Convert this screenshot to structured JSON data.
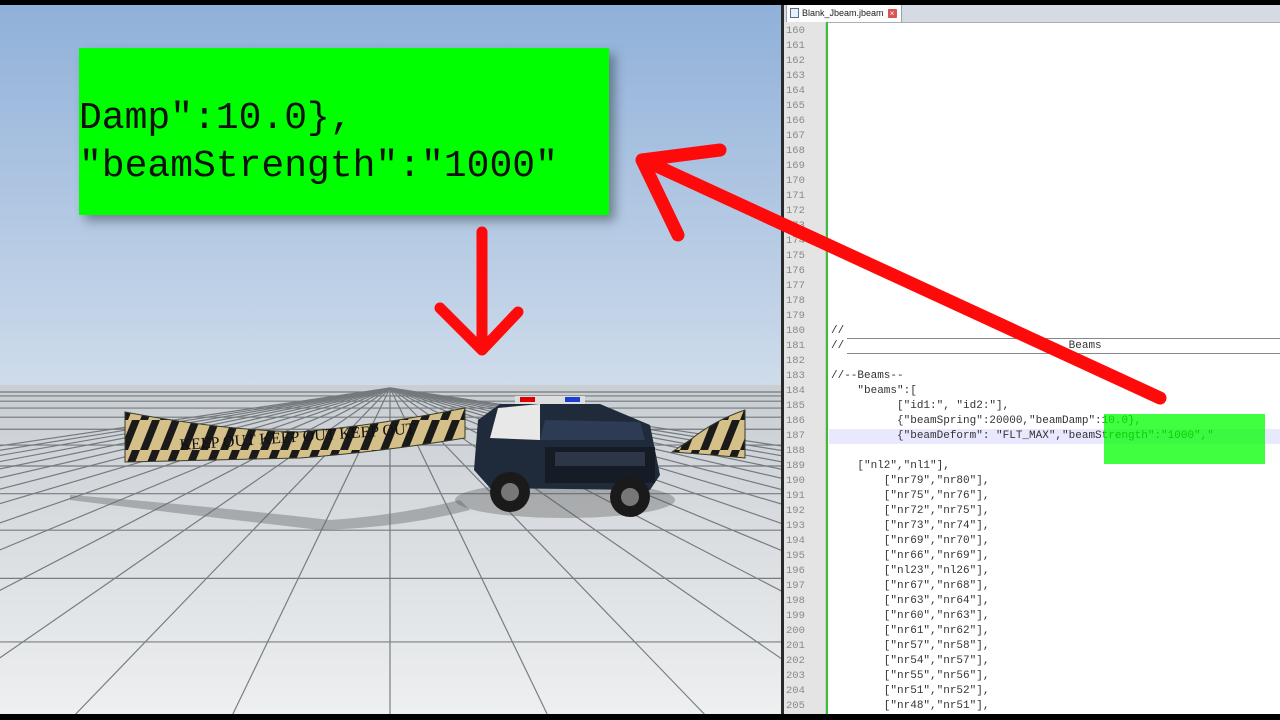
{
  "editor": {
    "tab_title": "Blank_Jbeam.jbeam",
    "line_numbers": [
      "160",
      "161",
      "162",
      "163",
      "164",
      "165",
      "166",
      "167",
      "168",
      "169",
      "170",
      "171",
      "172",
      "173",
      "174",
      "175",
      "176",
      "177",
      "178",
      "179",
      "180",
      "181",
      "182",
      "183",
      "184",
      "185",
      "186",
      "187",
      "188",
      "189",
      "190",
      "191",
      "192",
      "193",
      "194",
      "195",
      "196",
      "197",
      "198",
      "199",
      "200",
      "201",
      "202",
      "203",
      "204",
      "205"
    ],
    "code_lines": [
      {
        "line": "180",
        "text": "//"
      },
      {
        "line": "181",
        "text": "//                                  Beams"
      },
      {
        "line": "183",
        "text": "//--Beams--"
      },
      {
        "line": "184",
        "text": "    \"beams\":["
      },
      {
        "line": "185",
        "text": "          [\"id1:\", \"id2:\"],"
      },
      {
        "line": "186",
        "text": "          {\"beamSpring\":20000,\"beamDamp\":10.0},"
      },
      {
        "line": "187",
        "text": "          {\"beamDeform\": \"FLT_MAX\",\"beamStrength\":\"1000\",\""
      },
      {
        "line": "189",
        "text": "    [\"nl2\",\"nl1\"],"
      },
      {
        "line": "190",
        "text": "        [\"nr79\",\"nr80\"],"
      },
      {
        "line": "191",
        "text": "        [\"nr75\",\"nr76\"],"
      },
      {
        "line": "192",
        "text": "        [\"nr72\",\"nr75\"],"
      },
      {
        "line": "193",
        "text": "        [\"nr73\",\"nr74\"],"
      },
      {
        "line": "194",
        "text": "        [\"nr69\",\"nr70\"],"
      },
      {
        "line": "195",
        "text": "        [\"nr66\",\"nr69\"],"
      },
      {
        "line": "196",
        "text": "        [\"nl23\",\"nl26\"],"
      },
      {
        "line": "197",
        "text": "        [\"nr67\",\"nr68\"],"
      },
      {
        "line": "198",
        "text": "        [\"nr63\",\"nr64\"],"
      },
      {
        "line": "199",
        "text": "        [\"nr60\",\"nr63\"],"
      },
      {
        "line": "200",
        "text": "        [\"nr61\",\"nr62\"],"
      },
      {
        "line": "201",
        "text": "        [\"nr57\",\"nr58\"],"
      },
      {
        "line": "202",
        "text": "        [\"nr54\",\"nr57\"],"
      },
      {
        "line": "203",
        "text": "        [\"nr55\",\"nr56\"],"
      },
      {
        "line": "204",
        "text": "        [\"nr51\",\"nr52\"],"
      },
      {
        "line": "205",
        "text": "        [\"nr48\",\"nr51\"],"
      }
    ]
  },
  "zoom_callout": {
    "line1": "Damp\":10.0},",
    "line2": "\"beamStrength\":\"1000\""
  },
  "scene": {
    "tape_text": "KEEP OUT"
  },
  "colors": {
    "highlight": "#00ff00",
    "arrow": "#ff0000",
    "sky": "#a9c1de"
  },
  "icons": [
    "file-icon",
    "close-icon",
    "arrow-icon"
  ]
}
